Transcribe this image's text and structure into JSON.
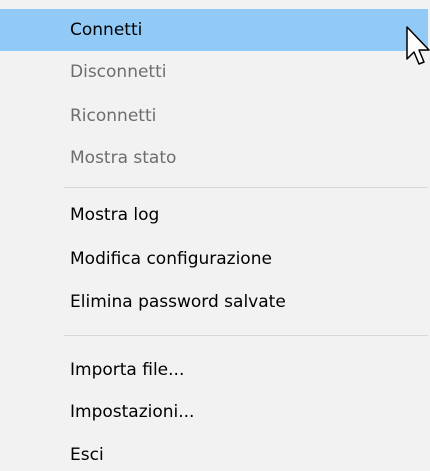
{
  "menu": {
    "items": [
      {
        "label": "Connetti",
        "enabled": true,
        "selected": true
      },
      {
        "label": "Disconnetti",
        "enabled": false
      },
      {
        "label": "Riconnetti",
        "enabled": false
      },
      {
        "label": "Mostra stato",
        "enabled": false
      },
      {
        "label": "Mostra log",
        "enabled": true
      },
      {
        "label": "Modifica configurazione",
        "enabled": true
      },
      {
        "label": "Elimina password salvate",
        "enabled": true
      },
      {
        "label": "Importa file...",
        "enabled": true
      },
      {
        "label": "Impostazioni...",
        "enabled": true
      },
      {
        "label": "Esci",
        "enabled": true
      }
    ]
  },
  "colors": {
    "highlight": "#91c9f7",
    "disabled_text": "#6d6d6d",
    "background": "#f2f2f2"
  },
  "icons": {
    "cursor": "mouse-pointer-icon"
  }
}
